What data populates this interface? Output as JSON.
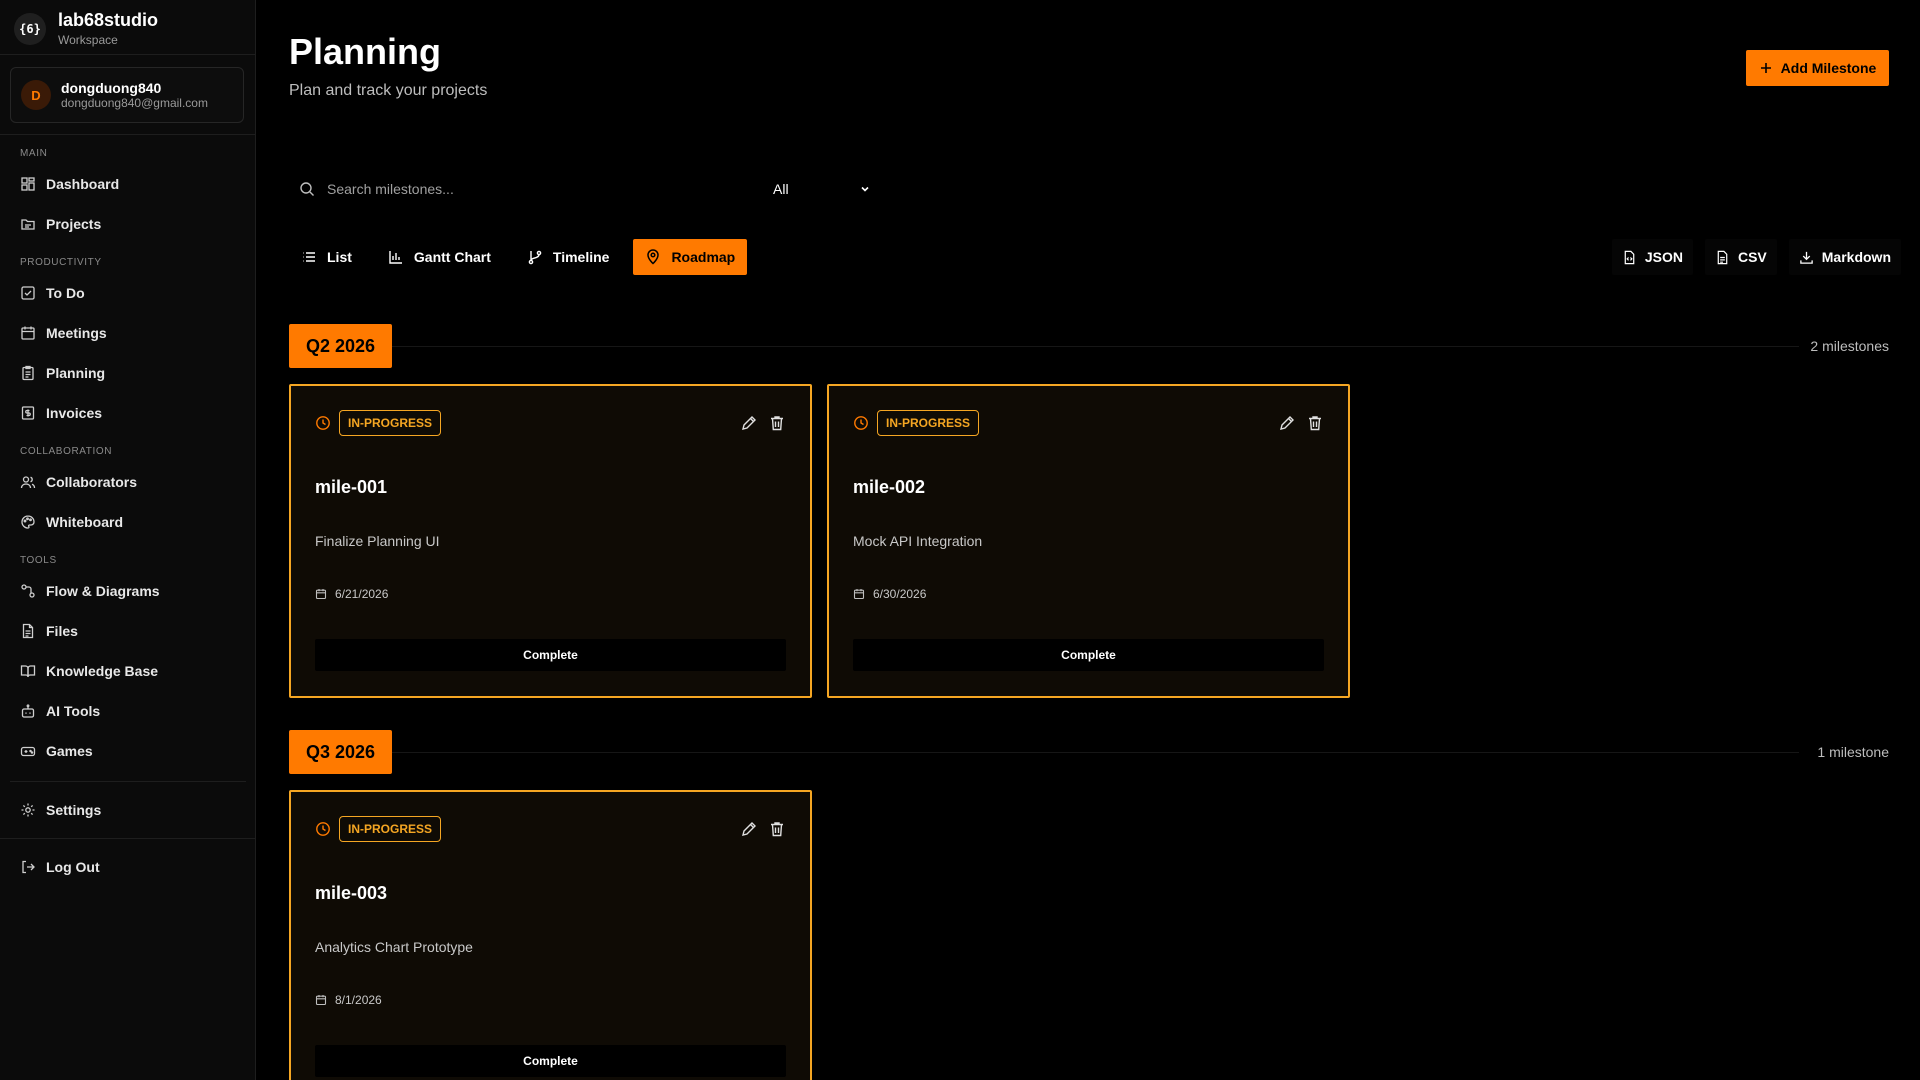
{
  "brand": {
    "name": "lab68studio",
    "subtitle": "Workspace",
    "logo_text": "{6}"
  },
  "user": {
    "initial": "D",
    "name": "dongduong840",
    "email": "dongduong840@gmail.com"
  },
  "sidebar": {
    "sections": {
      "main": "MAIN",
      "productivity": "PRODUCTIVITY",
      "collaboration": "COLLABORATION",
      "tools": "TOOLS"
    },
    "items": {
      "dashboard": "Dashboard",
      "projects": "Projects",
      "todo": "To Do",
      "meetings": "Meetings",
      "planning": "Planning",
      "invoices": "Invoices",
      "collaborators": "Collaborators",
      "whiteboard": "Whiteboard",
      "flow": "Flow & Diagrams",
      "files": "Files",
      "knowledge": "Knowledge Base",
      "ai": "AI Tools",
      "games": "Games",
      "settings": "Settings",
      "logout": "Log Out"
    }
  },
  "header": {
    "title": "Planning",
    "subtitle": "Plan and track your projects",
    "add_label": "Add Milestone"
  },
  "search": {
    "placeholder": "Search milestones...",
    "value": ""
  },
  "filter": {
    "selected": "All"
  },
  "view_tabs": [
    {
      "label": "List",
      "icon": "list-icon"
    },
    {
      "label": "Gantt Chart",
      "icon": "bar-chart-icon"
    },
    {
      "label": "Timeline",
      "icon": "git-branch-icon"
    },
    {
      "label": "Roadmap",
      "icon": "map-pin-icon",
      "active": true
    }
  ],
  "export": {
    "json": "JSON",
    "csv": "CSV",
    "markdown": "Markdown"
  },
  "quarters": [
    {
      "label": "Q2 2026",
      "count": "2 milestones",
      "milestones": [
        {
          "id": "mile-001",
          "status": "IN-PROGRESS",
          "description": "Finalize Planning UI",
          "date": "6/21/2026",
          "action": "Complete"
        },
        {
          "id": "mile-002",
          "status": "IN-PROGRESS",
          "description": "Mock API Integration",
          "date": "6/30/2026",
          "action": "Complete"
        }
      ]
    },
    {
      "label": "Q3 2026",
      "count": "1 milestone",
      "milestones": [
        {
          "id": "mile-003",
          "status": "IN-PROGRESS",
          "description": "Analytics Chart Prototype",
          "date": "8/1/2026",
          "action": "Complete"
        }
      ]
    }
  ],
  "colors": {
    "accent": "#ff7a00",
    "card_border": "#f5a623",
    "background": "#000000",
    "sidebar": "#0b0b0b"
  }
}
